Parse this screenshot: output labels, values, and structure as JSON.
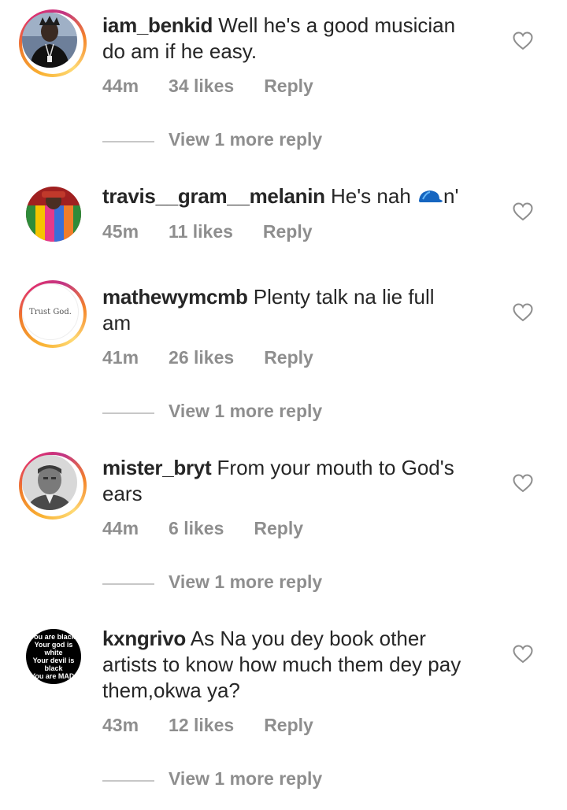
{
  "comments": [
    {
      "username": "iam_benkid",
      "text_line1": " Well he's a good musician",
      "text_line2": "do am if he easy.",
      "time": "44m",
      "likes": "34 likes",
      "reply": "Reply",
      "view_more": "View 1 more reply"
    },
    {
      "username": "travis__gram__melanin",
      "text_line1": " He's nah ",
      "text_tail": "n'",
      "time": "45m",
      "likes": "11 likes",
      "reply": "Reply"
    },
    {
      "username": "mathewymcmb",
      "text_line1": " Plenty talk na lie full",
      "text_line2": "am",
      "avatar_text": "Trust God.",
      "time": "41m",
      "likes": "26 likes",
      "reply": "Reply",
      "view_more": "View 1 more reply"
    },
    {
      "username": "mister_bryt",
      "text_line1": " From your mouth to God's",
      "text_line2": "ears",
      "time": "44m",
      "likes": "6 likes",
      "reply": "Reply",
      "view_more": "View 1 more reply"
    },
    {
      "username": "kxngrivo",
      "text_line1": " As Na you dey book other",
      "text_line2": "artists to know how much them dey pay",
      "text_line3": "them,okwa ya?",
      "avatar_lines": [
        "You are black.",
        "Your god is white",
        "Your devil is black",
        "You are MAD."
      ],
      "time": "43m",
      "likes": "12 likes",
      "reply": "Reply",
      "view_more": "View 1 more reply"
    }
  ],
  "icons": {
    "like": "heart-outline-icon",
    "cap": "blue-cap-emoji"
  },
  "colors": {
    "meta": "#8e8e8e",
    "text": "#262626",
    "divider": "#c7c7c7",
    "ring_start": "#f9b233",
    "ring_end": "#e1306c"
  }
}
